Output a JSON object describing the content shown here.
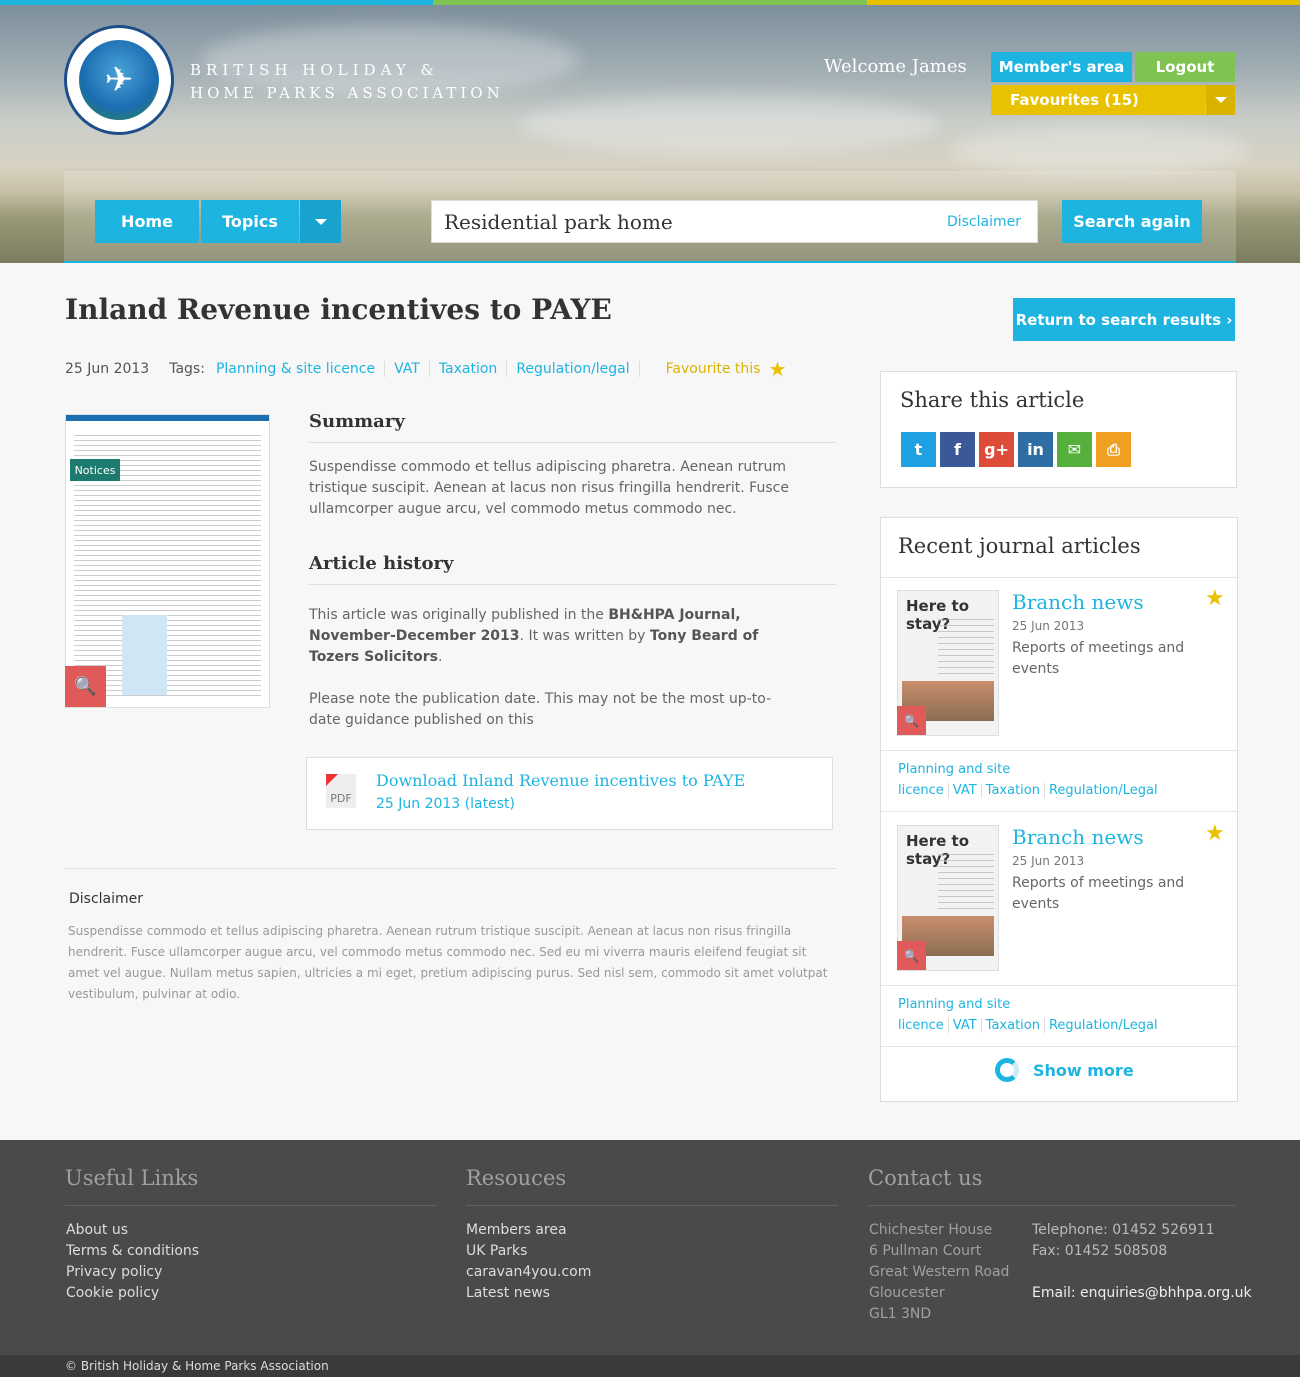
{
  "colors": {
    "accent": "#1eb4e0",
    "green": "#7fc352",
    "yellow": "#e8c200",
    "red": "#e05a5a",
    "footer": "#4a4a4a"
  },
  "header": {
    "org_line1": "BRITISH HOLIDAY &",
    "org_line2": "HOME PARKS ASSOCIATION",
    "welcome": "Welcome James",
    "members_area": "Member's area",
    "logout": "Logout",
    "favourites": "Favourites (15)"
  },
  "nav": {
    "home": "Home",
    "topics": "Topics",
    "search_value": "Residential park home",
    "disclaimer": "Disclaimer",
    "search_again": "Search again"
  },
  "article": {
    "title": "Inland Revenue incentives to PAYE",
    "return": "Return to search results ›",
    "date": "25 Jun 2013",
    "tags_label": "Tags:",
    "tags": [
      "Planning & site licence",
      "VAT",
      "Taxation",
      "Regulation/legal"
    ],
    "favourite": "Favourite this",
    "thumb_heading": "Notices",
    "summary_heading": "Summary",
    "summary": "Suspendisse commodo et tellus adipiscing pharetra. Aenean rutrum tristique suscipit. Aenean at lacus non risus fringilla hendrerit. Fusce ullamcorper augue arcu, vel commodo metus commodo nec.",
    "history_heading": "Article history",
    "history_p1_a": "This article was originally published in the ",
    "history_p1_b": "BH&HPA Journal, November-December 2013",
    "history_p1_c": ".  It was written by ",
    "history_p1_d": "Tony Beard of Tozers Solicitors",
    "history_p1_e": ".",
    "history_p2": "Please note the publication date. This may not be the most up-to-date guidance published on this",
    "pdf_label": "PDF",
    "download_title": "Download Inland Revenue incentives to PAYE",
    "download_date": "25 Jun 2013 (latest)",
    "disclaimer_heading": "Disclaimer",
    "disclaimer_text": "Suspendisse commodo et tellus adipiscing pharetra. Aenean rutrum tristique suscipit. Aenean at lacus non risus fringilla hendrerit. Fusce ullamcorper augue arcu, vel commodo metus commodo nec. Sed eu mi viverra mauris eleifend feugiat sit amet vel augue. Nullam metus sapien, ultricies a mi eget, pretium adipiscing purus. Sed nisl sem, commodo sit amet volutpat vestibulum, pulvinar at odio."
  },
  "share": {
    "heading": "Share this article",
    "icons": [
      "twitter-icon",
      "facebook-icon",
      "google-plus-icon",
      "linkedin-icon",
      "email-icon",
      "print-icon"
    ]
  },
  "recent": {
    "heading": "Recent journal articles",
    "items": [
      {
        "thumb_heading": "Here to stay?",
        "title": "Branch news",
        "date": "25 Jun 2013",
        "desc": "Reports of meetings and events",
        "tags": [
          "Planning and site licence",
          "VAT",
          "Taxation",
          "Regulation/Legal"
        ]
      },
      {
        "thumb_heading": "Here to stay?",
        "title": "Branch news",
        "date": "25 Jun 2013",
        "desc": "Reports of meetings and events",
        "tags": [
          "Planning and site licence",
          "VAT",
          "Taxation",
          "Regulation/Legal"
        ]
      }
    ],
    "show_more": "Show more"
  },
  "footer": {
    "useful_heading": "Useful Links",
    "useful": [
      "About us",
      "Terms & conditions",
      "Privacy policy",
      "Cookie policy"
    ],
    "resources_heading": "Resouces",
    "resources": [
      "Members area",
      "UK Parks",
      "caravan4you.com",
      "Latest news"
    ],
    "contact_heading": "Contact us",
    "address": [
      "Chichester House",
      "6 Pullman Court",
      "Great Western Road",
      "Gloucester",
      "GL1 3ND"
    ],
    "telephone": "Telephone: 01452 526911",
    "fax": "Fax: 01452 508508",
    "email": "Email: enquiries@bhhpa.org.uk",
    "copyright": "© British Holiday & Home Parks Association"
  }
}
